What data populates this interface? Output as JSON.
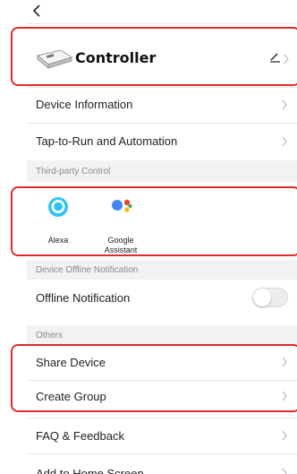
{
  "device": {
    "name": "Controller"
  },
  "menu": {
    "device_information": "Device Information",
    "tap_to_run": "Tap-to-Run and Automation",
    "offline_notification": "Offline Notification",
    "share_device": "Share Device",
    "create_group": "Create Group",
    "faq": "FAQ & Feedback",
    "add_home": "Add to Home Screen"
  },
  "sections": {
    "third_party": "Third-party Control",
    "offline": "Device Offline Notification",
    "others": "Others"
  },
  "third_party": [
    {
      "label": "Alexa",
      "icon": "alexa-icon"
    },
    {
      "label": "Google\nAssistant",
      "icon": "google-assistant-icon"
    }
  ],
  "toggles": {
    "offline_notification_on": false
  },
  "colors": {
    "highlight": "#e02b2b",
    "alexa": "#31c4f3",
    "google_blue": "#4285f4",
    "google_red": "#ea4335",
    "google_yellow": "#fbbc05",
    "google_green": "#34a853"
  }
}
